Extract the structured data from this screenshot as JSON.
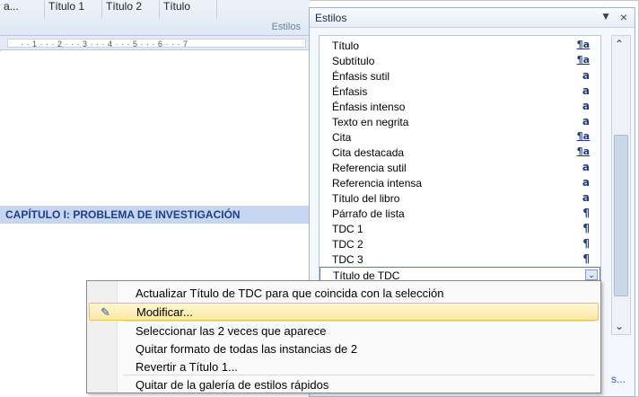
{
  "ribbon": {
    "gallery": [
      "a...",
      "Título 1",
      "Título 2",
      "Título"
    ],
    "group_label": "Estilos"
  },
  "ruler": {
    "marks": "· · 1 · · · 2 · · · 3 · · · 4 · · · 5 · · · 6 · · · 7"
  },
  "document": {
    "heading": "CAPÍTULO I: PROBLEMA DE INVESTIGACIÓN"
  },
  "pane": {
    "title": "Estilos",
    "dropdown_icon": "▼",
    "close_icon": "×",
    "link_text": "s...",
    "items": [
      {
        "label": "Título",
        "glyph": "¶a",
        "kind": "linked"
      },
      {
        "label": "Subtítulo",
        "glyph": "¶a",
        "kind": "linked"
      },
      {
        "label": "Énfasis sutil",
        "glyph": "a",
        "kind": "char"
      },
      {
        "label": "Énfasis",
        "glyph": "a",
        "kind": "char"
      },
      {
        "label": "Énfasis intenso",
        "glyph": "a",
        "kind": "char"
      },
      {
        "label": "Texto en negrita",
        "glyph": "a",
        "kind": "char"
      },
      {
        "label": "Cita",
        "glyph": "¶a",
        "kind": "linked"
      },
      {
        "label": "Cita destacada",
        "glyph": "¶a",
        "kind": "linked"
      },
      {
        "label": "Referencia sutil",
        "glyph": "a",
        "kind": "char"
      },
      {
        "label": "Referencia intensa",
        "glyph": "a",
        "kind": "char"
      },
      {
        "label": "Título del libro",
        "glyph": "a",
        "kind": "char"
      },
      {
        "label": "Párrafo de lista",
        "glyph": "¶",
        "kind": "para"
      },
      {
        "label": "TDC 1",
        "glyph": "¶",
        "kind": "para"
      },
      {
        "label": "TDC 2",
        "glyph": "¶",
        "kind": "para"
      },
      {
        "label": "TDC 3",
        "glyph": "¶",
        "kind": "para"
      },
      {
        "label": "Título de TDC",
        "glyph": "⌄",
        "kind": "selected"
      }
    ]
  },
  "menu": {
    "items": [
      {
        "text": "Actualizar Título de TDC para que coincida con la selección"
      },
      {
        "text": "Modificar...",
        "highlighted": true
      },
      {
        "text": "Seleccionar las 2 veces que aparece"
      },
      {
        "text": "Quitar formato de todas las instancias de 2"
      },
      {
        "text": "Revertir a Título 1..."
      },
      {
        "text": "Quitar de la galería de estilos rápidos"
      }
    ]
  },
  "colors": {
    "heading_bg": "#c5d6ee",
    "heading_text": "#1f3d8a",
    "menu_highlight": "#fde7a3",
    "accent": "#1e3a7a"
  }
}
